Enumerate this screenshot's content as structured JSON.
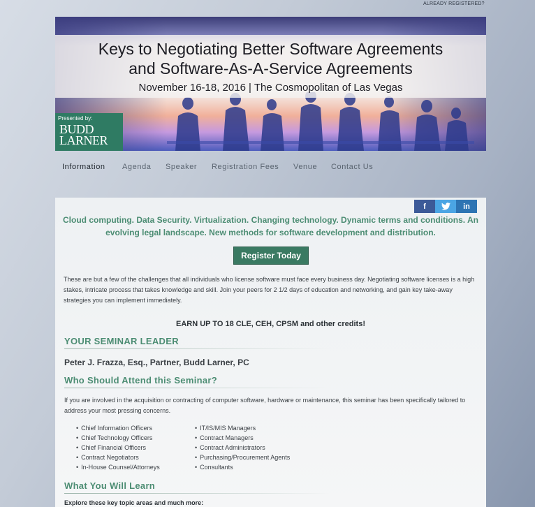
{
  "header": {
    "already_registered": "ALREADY REGISTERED?"
  },
  "banner": {
    "title_line1": "Keys to Negotiating Better Software Agreements",
    "title_line2": "and Software-As-A-Service Agreements",
    "dates": "November 16-18, 2016",
    "separator": "|",
    "venue": "The Cosmopolitan of Las Vegas",
    "presented_by": "Presented by:",
    "logo_line1": "BUDD",
    "logo_line2": "LARNER"
  },
  "nav": {
    "items": [
      {
        "label": "Information",
        "active": true
      },
      {
        "label": "Agenda"
      },
      {
        "label": "Speaker"
      },
      {
        "label": "Registration Fees"
      },
      {
        "label": "Venue"
      },
      {
        "label": "Contact Us"
      }
    ]
  },
  "social": {
    "facebook": "f",
    "twitter": "t",
    "linkedin": "in"
  },
  "main": {
    "intro": "Cloud computing. Data Security. Virtualization.  Changing technology.  Dynamic terms and conditions.  An evolving legal landscape.  New methods for software development and distribution.",
    "register_button": "Register Today",
    "body": "These are but a few of the challenges that all individuals who license software must face every business day. Negotiating software licenses is a high stakes, intricate process that takes knowledge and skill.  Join your peers for 2 1/2 days of education and networking, and gain key take-away strategies you can implement immediately.",
    "credits": "EARN UP TO 18 CLE, CEH, CPSM and other credits!",
    "leader_heading": "YOUR SEMINAR LEADER",
    "leader_name": "Peter J. Frazza, Esq., Partner, Budd Larner, PC",
    "attend_heading": "Who Should Attend this Seminar?",
    "attend_text": "If you are involved in the acquisition or contracting of computer software, hardware or maintenance, this seminar has been specifically tailored to address your most pressing concerns.",
    "attendees_left": [
      "Chief Information Officers",
      "Chief Technology Officers",
      "Chief Financial Officers",
      "Contract Negotiators",
      "In-House Counsel/Attorneys"
    ],
    "attendees_right": [
      "IT/IS/MIS Managers",
      "Contract Managers",
      "Contract Administrators",
      "Purchasing/Procurement Agents",
      "Consultants"
    ],
    "learn_heading": "What You Will Learn",
    "explore": "Explore these key topic areas and much more:"
  },
  "colors": {
    "accent_green": "#4c8d73",
    "button_green": "#3a7a62",
    "facebook": "#3c5a98",
    "twitter": "#4ba5e4",
    "linkedin": "#2d74b3"
  }
}
